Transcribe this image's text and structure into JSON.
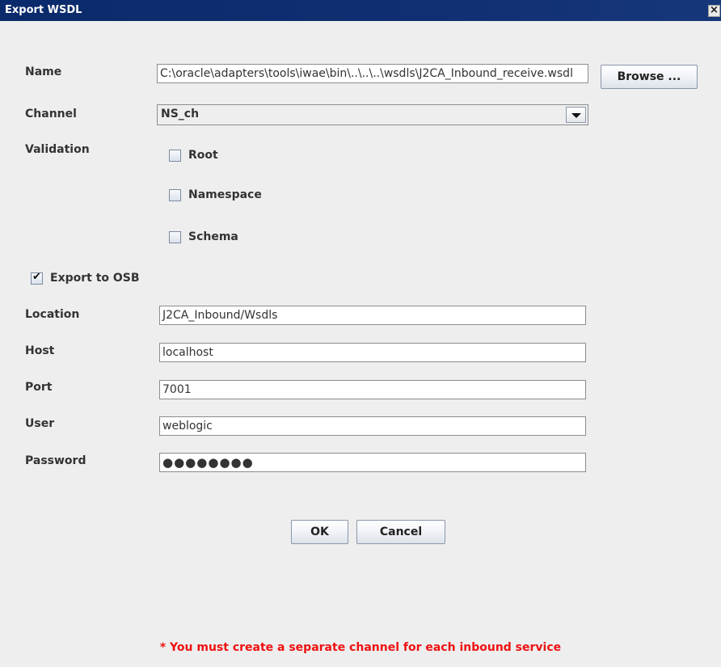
{
  "window": {
    "title": "Export WSDL",
    "close_glyph": "×"
  },
  "form": {
    "name": {
      "label": "Name",
      "value": "C:\\oracle\\adapters\\tools\\iwae\\bin\\..\\..\\..\\wsdls\\J2CA_Inbound_receive.wsdl"
    },
    "browse_label": "Browse ...",
    "channel": {
      "label": "Channel",
      "value": "NS_ch"
    },
    "validation": {
      "label": "Validation",
      "options": [
        {
          "label": "Root",
          "checked": false
        },
        {
          "label": "Namespace",
          "checked": false
        },
        {
          "label": "Schema",
          "checked": false
        }
      ]
    },
    "export_to_osb": {
      "label": "Export to OSB",
      "checked": true,
      "check_glyph": "✔"
    },
    "location": {
      "label": "Location",
      "value": "J2CA_Inbound/Wsdls"
    },
    "host": {
      "label": "Host",
      "value": "localhost"
    },
    "port": {
      "label": "Port",
      "value": "7001"
    },
    "user": {
      "label": "User",
      "value": "weblogic"
    },
    "password": {
      "label": "Password",
      "value": "●●●●●●●●"
    }
  },
  "buttons": {
    "ok": "OK",
    "cancel": "Cancel"
  },
  "footnote": "* You must create a separate channel for each inbound service",
  "colors": {
    "titlebar": "#0c2a66",
    "footnote": "#ee1111",
    "background": "#eeeeee"
  },
  "icons": {
    "close": "close-icon",
    "dropdown": "chevron-down-icon",
    "check": "checkmark-icon"
  }
}
